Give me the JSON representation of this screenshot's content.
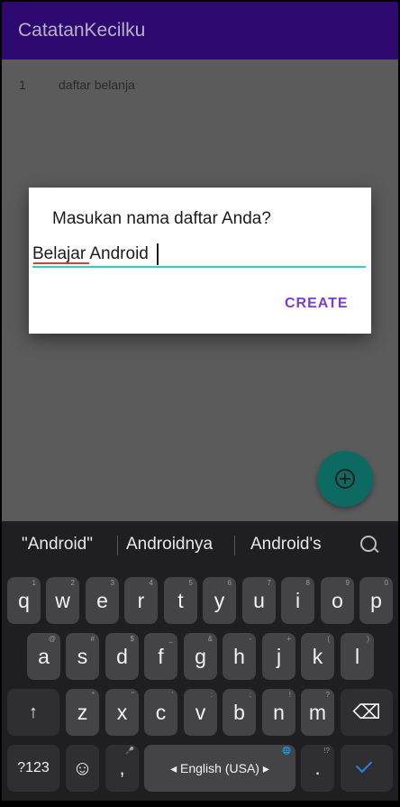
{
  "app": {
    "title": "CatatanKecilku"
  },
  "list": {
    "items": [
      {
        "number": "1",
        "name": "daftar belanja"
      }
    ]
  },
  "dialog": {
    "title": "Masukan nama daftar Anda?",
    "input_value": "Belajar Android",
    "create_label": "CREATE"
  },
  "fab": {
    "icon": "add-circle-icon"
  },
  "keyboard": {
    "suggestions": [
      "\"Android\"",
      "Androidnya",
      "Android's"
    ],
    "row1": [
      "q",
      "w",
      "e",
      "r",
      "t",
      "y",
      "u",
      "i",
      "o",
      "p"
    ],
    "row1_hints": [
      "1",
      "2",
      "3",
      "4",
      "5",
      "6",
      "7",
      "8",
      "9",
      "0"
    ],
    "row2": [
      "a",
      "s",
      "d",
      "f",
      "g",
      "h",
      "j",
      "k",
      "l"
    ],
    "row2_hints": [
      "@",
      "#",
      "$",
      "_",
      "&",
      "-",
      "+",
      "(",
      ")"
    ],
    "row3": [
      "z",
      "x",
      "c",
      "v",
      "b",
      "n",
      "m"
    ],
    "row3_hints": [
      "*",
      "\"",
      "'",
      ":",
      ";",
      "!",
      "?"
    ],
    "shift": "↑",
    "backspace": "⌫",
    "numbers_label": "?123",
    "emoji": "☺",
    "comma": ",",
    "comma_hint": "🎤",
    "space_label": "◂ English (USA) ▸",
    "space_hint": "🌐",
    "period": ".",
    "period_hint": "!?"
  },
  "colors": {
    "appbar": "#2e0a70",
    "accent": "#28d3c0",
    "fab": "#0d6a62",
    "create": "#7a3bdb"
  }
}
